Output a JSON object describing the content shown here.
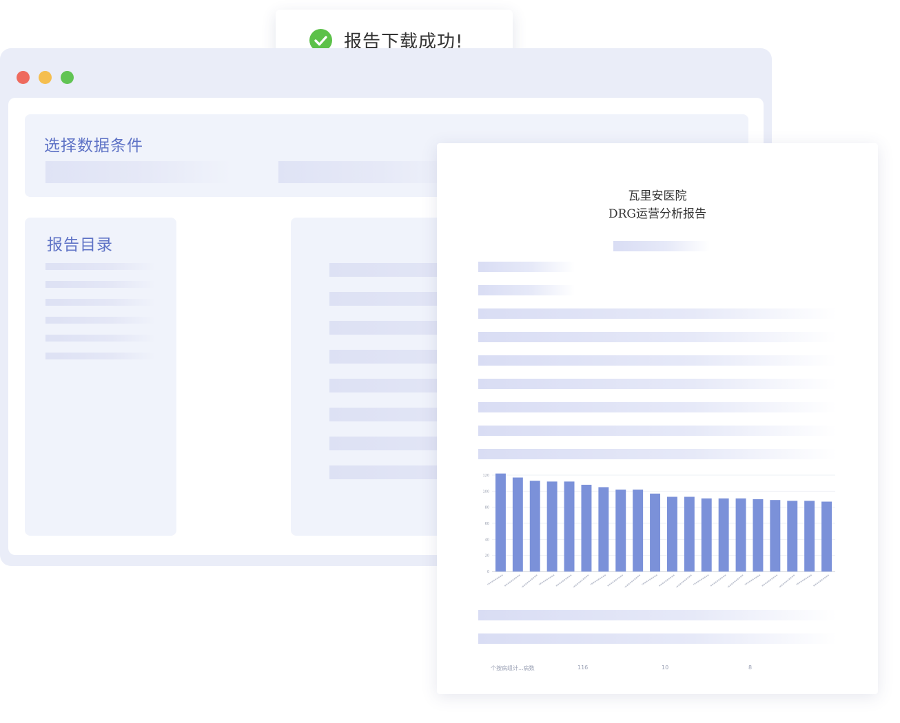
{
  "toast": {
    "icon": "check-circle-icon",
    "message": "报告下载成功!",
    "color": "#5cc149"
  },
  "window": {
    "controls": [
      "close-dot",
      "minimize-dot",
      "maximize-dot"
    ]
  },
  "filters_panel": {
    "title": "选择数据条件"
  },
  "toc_panel": {
    "title": "报告目录"
  },
  "report": {
    "hospital": "瓦里安医院",
    "title": "DRG运营分析报告",
    "footer": [
      "个按病组计...病数",
      "116",
      "10",
      "8"
    ]
  },
  "chart_data": {
    "type": "bar",
    "color": "#7b91d9",
    "ylim": [
      0,
      120
    ],
    "yticks": [
      0,
      20,
      40,
      60,
      80,
      100,
      120
    ],
    "values": [
      122,
      117,
      113,
      112,
      112,
      108,
      105,
      102,
      102,
      97,
      93,
      93,
      91,
      91,
      91,
      90,
      89,
      88,
      88,
      87
    ]
  }
}
